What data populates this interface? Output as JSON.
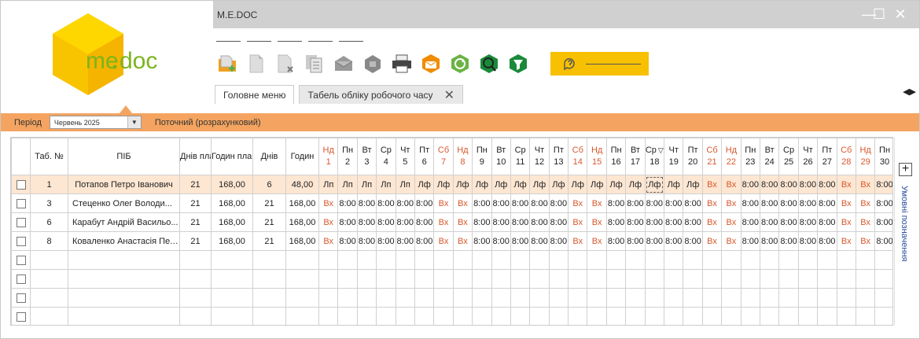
{
  "window": {
    "title": "M.E.DOC",
    "controls": [
      "—",
      "☐",
      "✕"
    ]
  },
  "logo": {
    "text_me": "me",
    "text_doc": "doc",
    "colors": {
      "hex_light": "#ffd700",
      "hex_dark": "#f4b400",
      "text": "#7ab51d"
    }
  },
  "toolbar": {
    "icons": [
      "new-document-icon",
      "document-icon",
      "delete-document-icon",
      "copy-documents-icon",
      "envelope-icon",
      "archive-box-icon",
      "printer-icon",
      "send-envelope-icon",
      "refresh-icon",
      "search-icon",
      "filter-icon"
    ],
    "help_icon": "help-chat-icon"
  },
  "tabs": {
    "main_menu": "Головне меню",
    "timesheet": "Табель обліку робочого часу",
    "close": "✕"
  },
  "tab_arrows": "◀▶",
  "period": {
    "label": "Період",
    "value": "Червень 2025",
    "caret": "▼",
    "note": "Поточний (розрахунковий)"
  },
  "table": {
    "headers": {
      "tab_no": "Таб. №",
      "name": "ПІБ",
      "days_plan": "Днів план",
      "hours_plan": "Годин план",
      "days": "Днів",
      "hours": "Годин"
    },
    "days": [
      {
        "dow": "Нд",
        "num": "1",
        "wk": true
      },
      {
        "dow": "Пн",
        "num": "2"
      },
      {
        "dow": "Вт",
        "num": "3"
      },
      {
        "dow": "Ср",
        "num": "4"
      },
      {
        "dow": "Чт",
        "num": "5"
      },
      {
        "dow": "Пт",
        "num": "6"
      },
      {
        "dow": "Сб",
        "num": "7",
        "wk": true
      },
      {
        "dow": "Нд",
        "num": "8",
        "wk": true
      },
      {
        "dow": "Пн",
        "num": "9"
      },
      {
        "dow": "Вт",
        "num": "10"
      },
      {
        "dow": "Ср",
        "num": "11"
      },
      {
        "dow": "Чт",
        "num": "12"
      },
      {
        "dow": "Пт",
        "num": "13"
      },
      {
        "dow": "Сб",
        "num": "14",
        "wk": true
      },
      {
        "dow": "Нд",
        "num": "15",
        "wk": true
      },
      {
        "dow": "Пн",
        "num": "16"
      },
      {
        "dow": "Вт",
        "num": "17"
      },
      {
        "dow": "Ср",
        "num": "18",
        "filter": true
      },
      {
        "dow": "Чт",
        "num": "19"
      },
      {
        "dow": "Пт",
        "num": "20"
      },
      {
        "dow": "Сб",
        "num": "21",
        "wk": true
      },
      {
        "dow": "Нд",
        "num": "22",
        "wk": true
      },
      {
        "dow": "Пн",
        "num": "23"
      },
      {
        "dow": "Вт",
        "num": "24"
      },
      {
        "dow": "Ср",
        "num": "25"
      },
      {
        "dow": "Чт",
        "num": "26"
      },
      {
        "dow": "Пт",
        "num": "27"
      },
      {
        "dow": "Сб",
        "num": "28",
        "wk": true
      },
      {
        "dow": "Нд",
        "num": "29",
        "wk": true
      },
      {
        "dow": "Пн",
        "num": "30"
      }
    ],
    "filter_glyph": "▽",
    "rows": [
      {
        "tab_no": "1",
        "name": "Потапов Петро Іванович",
        "days_plan": "21",
        "hours_plan": "168,00",
        "days": "6",
        "hours": "48,00",
        "cells": [
          "Лп",
          "Лп",
          "Лп",
          "Лп",
          "Лп",
          "Лф",
          "Лф",
          "Лф",
          "Лф",
          "Лф",
          "Лф",
          "Лф",
          "Лф",
          "Лф",
          "Лф",
          "Лф",
          "Лф",
          "Лф",
          "Лф",
          "Лф",
          "Вх",
          "Вх",
          "8:00",
          "8:00",
          "8:00",
          "8:00",
          "8:00",
          "Вх",
          "Вх",
          "8:00"
        ]
      },
      {
        "tab_no": "3",
        "name": "Стеценко Олег Володи...",
        "days_plan": "21",
        "hours_plan": "168,00",
        "days": "21",
        "hours": "168,00",
        "cells": [
          "Вх",
          "8:00",
          "8:00",
          "8:00",
          "8:00",
          "8:00",
          "Вх",
          "Вх",
          "8:00",
          "8:00",
          "8:00",
          "8:00",
          "8:00",
          "Вх",
          "Вх",
          "8:00",
          "8:00",
          "8:00",
          "8:00",
          "8:00",
          "Вх",
          "Вх",
          "8:00",
          "8:00",
          "8:00",
          "8:00",
          "8:00",
          "Вх",
          "Вх",
          "8:00"
        ]
      },
      {
        "tab_no": "6",
        "name": "Карабут Андрій Васильо...",
        "days_plan": "21",
        "hours_plan": "168,00",
        "days": "21",
        "hours": "168,00",
        "cells": [
          "Вх",
          "8:00",
          "8:00",
          "8:00",
          "8:00",
          "8:00",
          "Вх",
          "Вх",
          "8:00",
          "8:00",
          "8:00",
          "8:00",
          "8:00",
          "Вх",
          "Вх",
          "8:00",
          "8:00",
          "8:00",
          "8:00",
          "8:00",
          "Вх",
          "Вх",
          "8:00",
          "8:00",
          "8:00",
          "8:00",
          "8:00",
          "Вх",
          "Вх",
          "8:00"
        ]
      },
      {
        "tab_no": "8",
        "name": "Коваленко Анастасія Пет...",
        "days_plan": "21",
        "hours_plan": "168,00",
        "days": "21",
        "hours": "168,00",
        "cells": [
          "Вх",
          "8:00",
          "8:00",
          "8:00",
          "8:00",
          "8:00",
          "Вх",
          "Вх",
          "8:00",
          "8:00",
          "8:00",
          "8:00",
          "8:00",
          "Вх",
          "Вх",
          "8:00",
          "8:00",
          "8:00",
          "8:00",
          "8:00",
          "Вх",
          "Вх",
          "8:00",
          "8:00",
          "8:00",
          "8:00",
          "8:00",
          "Вх",
          "Вх",
          "8:00"
        ]
      }
    ],
    "empty_rows": 4
  },
  "side_panel": {
    "plus": "+",
    "label": "Умовні позначення"
  },
  "colors": {
    "accent_orange": "#f4a460",
    "weekend_red": "#d9582c",
    "selected_row": "#fde6d2",
    "help_yellow": "#f7c000",
    "titlebar": "#d0d0d0"
  }
}
